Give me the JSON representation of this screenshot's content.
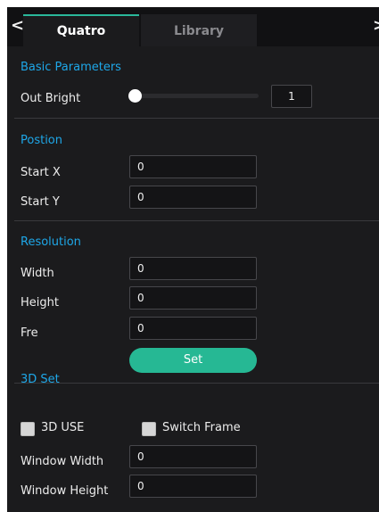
{
  "tabs": {
    "active_label": "Quatro",
    "inactive_label": "Library",
    "prev_arrow": "‹",
    "next_arrow": "›"
  },
  "basic": {
    "title": "Basic Parameters",
    "out_bright_label": "Out Bright",
    "out_bright_value": "1",
    "out_bright_level": 0
  },
  "position": {
    "title": "Postion",
    "start_x_label": "Start X",
    "start_x_value": "0",
    "start_y_label": "Start Y",
    "start_y_value": "0"
  },
  "resolution": {
    "title": "Resolution",
    "width_label": "Width",
    "width_value": "0",
    "height_label": "Height",
    "height_value": "0",
    "fre_label": "Fre",
    "fre_value": "0",
    "set_label": "Set"
  },
  "set3d": {
    "title": "3D Set",
    "use_label": "3D USE",
    "switch_label": "Switch Frame",
    "window_width_label": "Window Width",
    "window_width_value": "0",
    "window_height_label": "Window Height",
    "window_height_value": "0"
  },
  "colors": {
    "accent_blue": "#1ea7e8",
    "accent_green": "#26b894",
    "background": "#1b1b1d"
  }
}
